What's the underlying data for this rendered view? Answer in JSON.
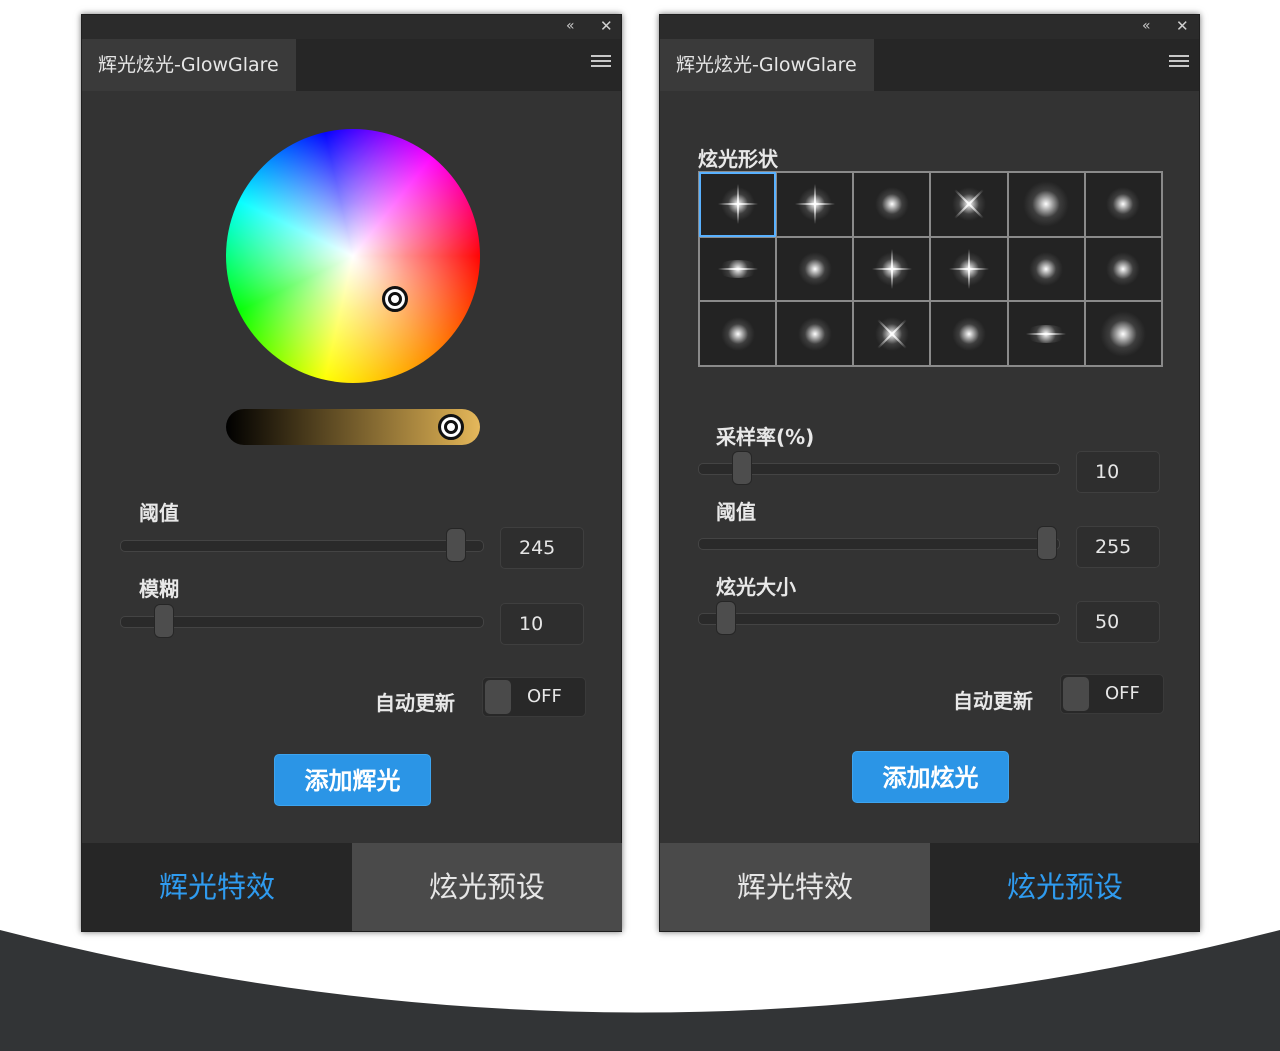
{
  "colors": {
    "accent": "#2b95e6",
    "active_tab_text": "#2f9bef",
    "panel_bg": "#333333",
    "bottom_arc": "#323436"
  },
  "panels": [
    {
      "title": "辉光炫光-GlowGlare",
      "icons": [
        "collapse-icon",
        "close-icon",
        "menu-icon"
      ],
      "collapse_glyph": "«",
      "close_glyph": "✕",
      "threshold": {
        "label": "阈值",
        "value": "245"
      },
      "blur": {
        "label": "模糊",
        "value": "10"
      },
      "auto_update": {
        "label": "自动更新",
        "state": "OFF"
      },
      "action_label": "添加辉光",
      "tabs": [
        {
          "label": "辉光特效",
          "active": true
        },
        {
          "label": "炫光预设",
          "active": false
        }
      ]
    },
    {
      "title": "辉光炫光-GlowGlare",
      "icons": [
        "collapse-icon",
        "close-icon",
        "menu-icon"
      ],
      "collapse_glyph": "«",
      "close_glyph": "✕",
      "shape_label": "炫光形状",
      "flare_shapes": [
        "star-cross",
        "star-cross",
        "glow",
        "star-diag",
        "soft",
        "glow",
        "flat",
        "glow",
        "star-cross",
        "star-cross",
        "glow",
        "glow",
        "glow",
        "glow",
        "star-diag",
        "glow",
        "flat",
        "soft"
      ],
      "selected_shape": 0,
      "sample_rate": {
        "label": "采样率(%)",
        "value": "10"
      },
      "threshold": {
        "label": "阈值",
        "value": "255"
      },
      "flare_size": {
        "label": "炫光大小",
        "value": "50"
      },
      "auto_update": {
        "label": "自动更新",
        "state": "OFF"
      },
      "action_label": "添加炫光",
      "tabs": [
        {
          "label": "辉光特效",
          "active": false
        },
        {
          "label": "炫光预设",
          "active": true
        }
      ]
    }
  ]
}
